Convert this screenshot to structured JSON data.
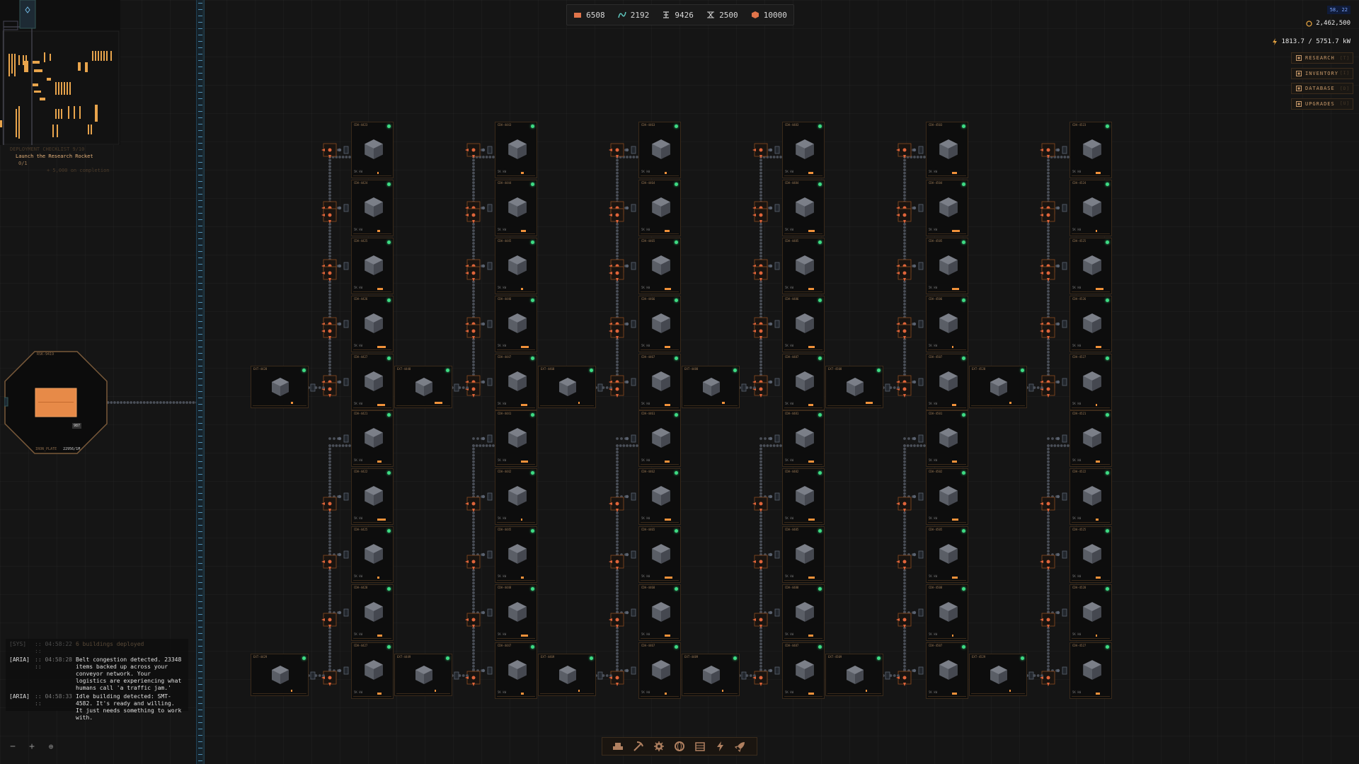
{
  "resources": [
    {
      "name": "iron-plate-icon",
      "value": "6508",
      "color": "#e0744a"
    },
    {
      "name": "wire-icon",
      "value": "2192",
      "color": "#5fc9c0"
    },
    {
      "name": "gear-part-icon",
      "value": "9426",
      "color": "#cccccc"
    },
    {
      "name": "circuit-icon",
      "value": "2500",
      "color": "#cccccc"
    },
    {
      "name": "ore-cube-icon",
      "value": "10000",
      "color": "#e0744a"
    }
  ],
  "hud": {
    "coords": "58, 22",
    "credits": "2,462,500",
    "power": "1813.7 / 5751.7 kW"
  },
  "menu": [
    {
      "label": "RESEARCH",
      "key": "[T]"
    },
    {
      "label": "INVENTORY",
      "key": "[I]"
    },
    {
      "label": "DATABASE",
      "key": "[D]"
    },
    {
      "label": "UPGRADES",
      "key": "[U]"
    }
  ],
  "objective": {
    "header": "DEPLOYMENT CHECKLIST 9/10",
    "title": "Launch the Research Rocket",
    "progress": "0/1",
    "reward": "+ 5,000 on completion"
  },
  "rocket": {
    "label_top": "RSK-9419",
    "label_bottom": "IRON_PLATE",
    "label_bottom_value": "22956/1M",
    "badge": "987"
  },
  "log": [
    {
      "tag": "[SYS]",
      "time": ":: 04:58:22 ::",
      "msg": "6 buildings deployed",
      "type": "sys"
    },
    {
      "tag": "[ARIA]",
      "time": ":: 04:58:28 ::",
      "msg": "Belt congestion detected. 23348 items backed up across your conveyor network. Your logistics are experiencing what humans call 'a traffic jam.'",
      "type": "aria"
    },
    {
      "tag": "[ARIA]",
      "time": ":: 04:58:33 ::",
      "msg": "Idle building detected: SMT-4582. It's ready and willing. It just needs something to work with.",
      "type": "aria"
    }
  ],
  "zoom": {
    "minus": "−",
    "plus": "+",
    "reset": "⊕"
  },
  "toolbar": [
    "conveyor-icon",
    "pickaxe-icon",
    "gear-icon",
    "research-orb-icon",
    "storage-icon",
    "power-icon",
    "rocket-icon"
  ],
  "factory": {
    "column_codes": [
      "4423",
      "4443",
      "4463",
      "4483",
      "4503",
      "4523"
    ],
    "row_top_suffix": [
      "3",
      "4",
      "5",
      "6",
      "7"
    ],
    "row_bottom_suffix": [
      "1",
      "2",
      "5",
      "8",
      "7"
    ],
    "power_label": "5K kW",
    "progress": [
      [
        0.08,
        0.2,
        0.35,
        0.55,
        0.5,
        0.25,
        0.55,
        0.15,
        0.3,
        0.25
      ],
      [
        0.2,
        0.3,
        0.15,
        0.5,
        0.4,
        0.45,
        0.05,
        0.2,
        0.45,
        0.2
      ],
      [
        0.15,
        0.3,
        0.4,
        0.35,
        0.35,
        0.3,
        0.4,
        0.5,
        0.35,
        0.15
      ],
      [
        0.3,
        0.4,
        0.35,
        0.4,
        0.3,
        0.35,
        0.4,
        0.4,
        0.3,
        0.35
      ],
      [
        0.3,
        0.5,
        0.45,
        0.05,
        0.25,
        0.3,
        0.4,
        0.35,
        0.1,
        0.3
      ],
      [
        0.3,
        0.05,
        0.5,
        0.35,
        0.1,
        0.25,
        0.2,
        0.3,
        0.1,
        0.25
      ]
    ],
    "extractor_progress": [
      0.15,
      0.55,
      0.0,
      0.2,
      0.5,
      0.15
    ],
    "extractor_progress_bottom": [
      0.1,
      0.05,
      0.05,
      0.0,
      0.0,
      0.0
    ]
  }
}
